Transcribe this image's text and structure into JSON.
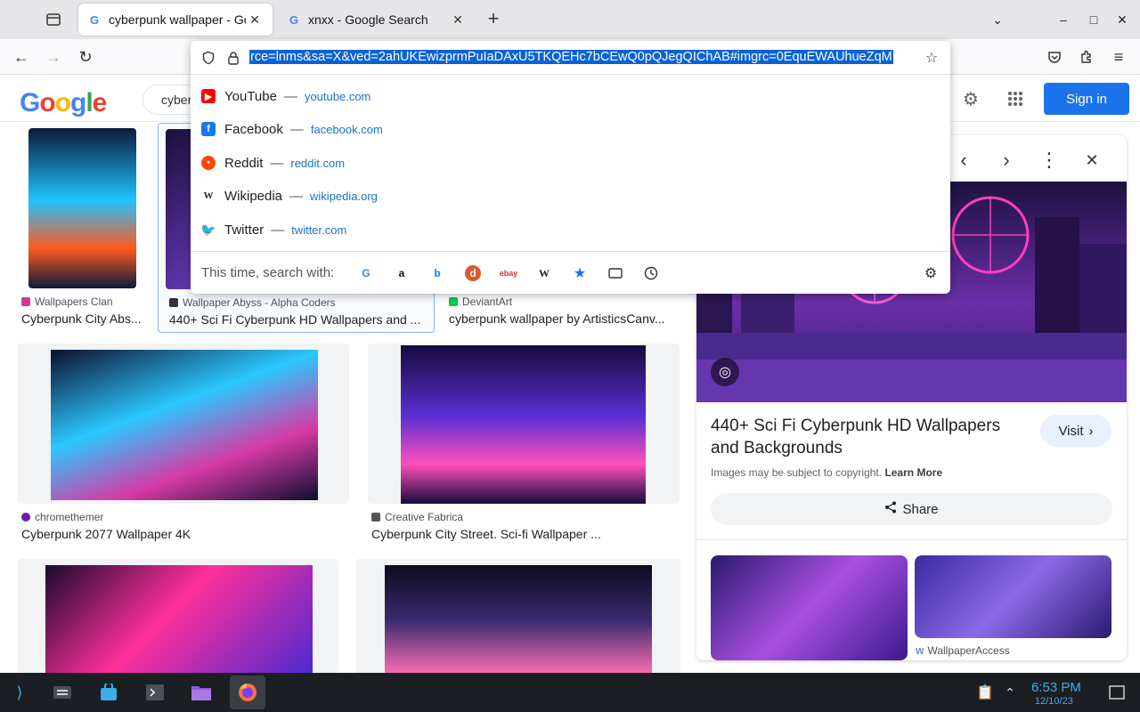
{
  "browser": {
    "tabs": [
      {
        "title": "cyberpunk wallpaper - Go",
        "favicon": "G",
        "active": true
      },
      {
        "title": "xnxx - Google Search",
        "favicon": "G",
        "active": false
      }
    ],
    "url_full": "rce=lnms&sa=X&ved=2ahUKEwizprmPuIaDAxU5TKQEHc7bCEwQ0pQJegQIChAB#imgrc=0EquEWAUhueZqM",
    "suggestions": [
      {
        "name": "YouTube",
        "url": "youtube.com",
        "color": "#ff0000",
        "glyph": "▶"
      },
      {
        "name": "Facebook",
        "url": "facebook.com",
        "color": "#1877f2",
        "glyph": "f"
      },
      {
        "name": "Reddit",
        "url": "reddit.com",
        "color": "#ff4500",
        "glyph": "•"
      },
      {
        "name": "Wikipedia",
        "url": "wikipedia.org",
        "color": "#ffffff",
        "glyph": "W"
      },
      {
        "name": "Twitter",
        "url": "twitter.com",
        "color": "#1da1f2",
        "glyph": "t"
      }
    ],
    "search_with_label": "This time, search with:"
  },
  "google": {
    "logo": "Google",
    "query": "cyber",
    "sign_in": "Sign in"
  },
  "results": [
    {
      "source": "Wallpapers Clan",
      "caption": "Cyberpunk City Abs...",
      "colors": [
        "#0b1a3a",
        "#ff5a1f",
        "#1fc3ff"
      ]
    },
    {
      "source": "Wallpaper Abyss - Alpha Coders",
      "caption": "440+ Sci Fi Cyberpunk HD Wallpapers and ...",
      "colors": [
        "#1b0f3a",
        "#6d3cc4",
        "#f05fd0"
      ]
    },
    {
      "source": "DeviantArt",
      "caption": "cyberpunk wallpaper by ArtisticsCanv...",
      "colors": [
        "#0c2a2a",
        "#1aa38a",
        "#e44"
      ]
    },
    {
      "source": "chromethemer",
      "caption": "Cyberpunk 2077 Wallpaper 4K",
      "colors": [
        "#0d0f2e",
        "#d63aa6",
        "#2ac8ff"
      ]
    },
    {
      "source": "Creative Fabrica",
      "caption": "Cyberpunk City Street. Sci-fi Wallpaper ...",
      "colors": [
        "#160a3e",
        "#5b2fd4",
        "#ff4fb8"
      ]
    },
    {
      "source": "",
      "caption": "",
      "colors": [
        "#1a0a2e",
        "#ff2f9a",
        "#4a2ad1"
      ]
    },
    {
      "source": "",
      "caption": "",
      "colors": [
        "#0d0b1f",
        "#3a2a6e",
        "#ff6fb5"
      ]
    }
  ],
  "side_panel": {
    "title": "440+ Sci Fi Cyberpunk HD Wallpapers and Backgrounds",
    "visit": "Visit",
    "copyright": "Images may be subject to copyright.",
    "learn_more": "Learn More",
    "share": "Share",
    "related_source": "WallpaperAccess"
  },
  "taskbar": {
    "time": "6:53 PM",
    "date": "12/10/23"
  }
}
